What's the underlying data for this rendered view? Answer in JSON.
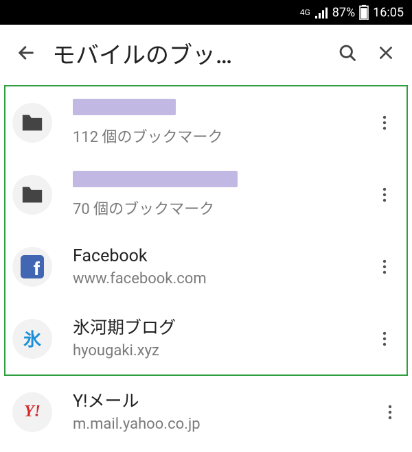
{
  "status": {
    "network_type": "4G",
    "battery_pct": "87%",
    "time": "16:05"
  },
  "header": {
    "title": "モバイルのブッ…"
  },
  "items": [
    {
      "type": "folder",
      "title_redacted": true,
      "subtitle": "112 個のブックマーク"
    },
    {
      "type": "folder",
      "title_redacted": true,
      "subtitle": "70 個のブックマーク"
    },
    {
      "type": "bookmark",
      "title": "Facebook",
      "subtitle": "www.facebook.com",
      "icon": "facebook"
    },
    {
      "type": "bookmark",
      "title": "氷河期ブログ",
      "subtitle": "hyougaki.xyz",
      "icon": "hyou"
    },
    {
      "type": "bookmark",
      "title": "Y!メール",
      "subtitle": "m.mail.yahoo.co.jp",
      "icon": "yahoo"
    }
  ]
}
